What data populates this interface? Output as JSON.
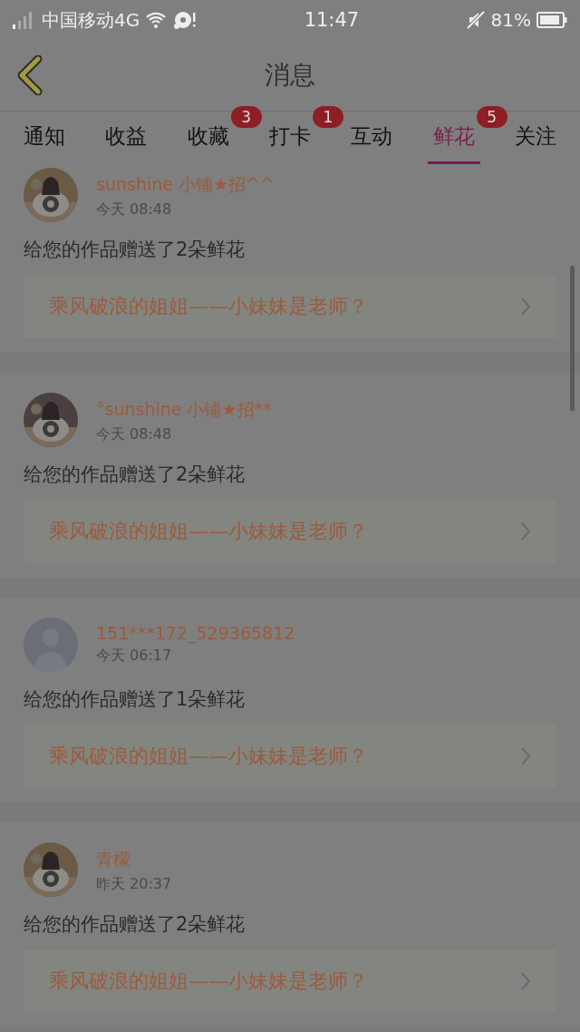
{
  "status_bar": {
    "carrier": "中国移动4G",
    "time": "11:47",
    "battery": "81%"
  },
  "header": {
    "title": "消息"
  },
  "tabs": [
    {
      "label": "通知",
      "selected": false
    },
    {
      "label": "收益",
      "selected": false
    },
    {
      "label": "收藏",
      "selected": false,
      "badge": "3"
    },
    {
      "label": "打卡",
      "selected": false,
      "badge": "1"
    },
    {
      "label": "互动",
      "selected": false
    },
    {
      "label": "鲜花",
      "selected": true,
      "badge": "5"
    },
    {
      "label": "关注",
      "selected": false
    }
  ],
  "messages": [
    {
      "kind": "picture",
      "name": "sunshine 小铺★招^^",
      "time": "今天 08:48",
      "text": "给您的作品赠送了2朵鲜花",
      "link": "乘风破浪的姐姐——小妹妹是老师？"
    },
    {
      "kind": "picture",
      "name": "°sunshine 小铺★招**",
      "time": "今天 08:48",
      "text": "给您的作品赠送了2朵鲜花",
      "link": "乘风破浪的姐姐——小妹妹是老师？"
    },
    {
      "kind": "default",
      "name": "151***172_529365812",
      "time": "今天 06:17",
      "text": "给您的作品赠送了1朵鲜花",
      "link": "乘风破浪的姐姐——小妹妹是老师？"
    },
    {
      "kind": "picture",
      "name": "青檬",
      "time": "昨天 20:37",
      "text": "给您的作品赠送了2朵鲜花",
      "link": "乘风破浪的姐姐——小妹妹是老师？"
    }
  ]
}
